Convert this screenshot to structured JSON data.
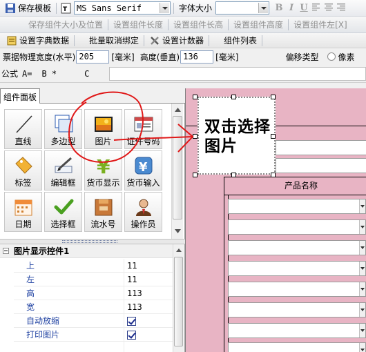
{
  "toolbar1": {
    "save_template": "保存模板",
    "font_name": "MS Sans Serif",
    "font_size_label": "字体大小",
    "font_size_value": "",
    "bold": "B",
    "italic": "I",
    "underline": "U"
  },
  "toolbar2": {
    "save_size_pos": "保存组件大小及位置",
    "set_length": "设置组件长度",
    "set_height_short": "设置组件长高",
    "set_height": "设置组件高度",
    "set_left": "设置组件左[X]"
  },
  "toolbar3": {
    "set_dictionary": "设置字典数据",
    "batch_unbind": "批量取消绑定",
    "set_counter": "设置计数器",
    "component_list": "组件列表"
  },
  "settings": {
    "width_label": "票据物理宽度(水平)",
    "width_value": "205",
    "unit1": "[毫米]",
    "height_label": "高度(垂直)",
    "height_value": "136",
    "unit2": "[毫米]",
    "offset_label": "偏移类型",
    "offset_option": "像素"
  },
  "formula": {
    "label": "公式",
    "a": "A=",
    "b": "B *",
    "c": "C"
  },
  "panel": {
    "tab_label": "组件面板",
    "tiles": [
      {
        "label": "直线",
        "icon": "line-icon"
      },
      {
        "label": "多边型",
        "icon": "polygon-icon"
      },
      {
        "label": "图片",
        "icon": "picture-icon"
      },
      {
        "label": "证件号码",
        "icon": "id-card-icon"
      },
      {
        "label": "标签",
        "icon": "tag-icon"
      },
      {
        "label": "编辑框",
        "icon": "edit-box-icon"
      },
      {
        "label": "货币显示",
        "icon": "currency-display-icon"
      },
      {
        "label": "货币输入",
        "icon": "currency-input-icon"
      },
      {
        "label": "日期",
        "icon": "calendar-icon"
      },
      {
        "label": "选择框",
        "icon": "checkbox-icon"
      },
      {
        "label": "流水号",
        "icon": "serial-number-icon"
      },
      {
        "label": "操作员",
        "icon": "operator-icon"
      }
    ]
  },
  "propgrid": {
    "category": "图片显示控件1",
    "rows": [
      {
        "name": "上",
        "value": "11"
      },
      {
        "name": "左",
        "value": "11"
      },
      {
        "name": "高",
        "value": "113"
      },
      {
        "name": "宽",
        "value": "113"
      },
      {
        "name": "自动放缩",
        "value": ""
      },
      {
        "name": "打印图片",
        "value": ""
      }
    ],
    "checked": {
      "auto_scale": true,
      "print_image": true
    }
  },
  "canvas": {
    "image_text": "双击选择图片",
    "column_header": "产品名称",
    "background": "#e8b4c4"
  }
}
